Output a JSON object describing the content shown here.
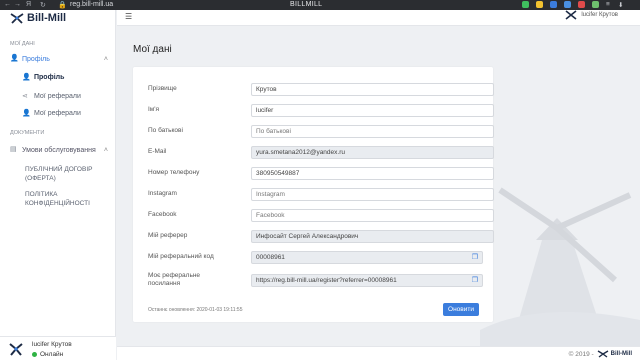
{
  "browser": {
    "url": "reg.bill-mill.ua",
    "title": "BILLMILL",
    "menu_glyph": "Я"
  },
  "brand": {
    "name": "Bill-Mill"
  },
  "sidebar": {
    "section_my_data": "МОЇ ДАНІ",
    "profile_group": "Профіль",
    "items": [
      {
        "label": "Профіль"
      },
      {
        "label": "Мої реферали"
      },
      {
        "label": "Мої реферали"
      }
    ],
    "section_documents": "ДОКУМЕНТИ",
    "terms_group": "Умови обслуговування",
    "docs": [
      {
        "label": "ПУБЛІЧНИЙ ДОГОВІР (Оферта)"
      },
      {
        "label": "ПОЛІТИКА КОНФІДЕНЦІЙНОСТІ"
      }
    ]
  },
  "user": {
    "name": "lucifer Крутов",
    "status": "Онлайн"
  },
  "topbar": {
    "user_name": "lucifer Крутов"
  },
  "page": {
    "title": "Мої дані"
  },
  "form": {
    "fields": [
      {
        "label": "Прізвище",
        "value": "Крутов",
        "placeholder": ""
      },
      {
        "label": "Ім'я",
        "value": "lucifer",
        "placeholder": ""
      },
      {
        "label": "По батькові",
        "value": "",
        "placeholder": "По батькові"
      },
      {
        "label": "E-Mail",
        "value": "yura.smetana2012@yandex.ru",
        "placeholder": ""
      },
      {
        "label": "Номер телефону",
        "value": "380950549887",
        "placeholder": ""
      },
      {
        "label": "Instagram",
        "value": "",
        "placeholder": "Instagram"
      },
      {
        "label": "Facebook",
        "value": "",
        "placeholder": "Facebook"
      },
      {
        "label": "Мій реферер",
        "value": "Инфосайт Сергей Александрович",
        "placeholder": ""
      },
      {
        "label": "Мій реферальний код",
        "value": "00008961",
        "placeholder": ""
      },
      {
        "label": "Моє реферальне посилання",
        "value": "https://reg.bill-mill.ua/register?referrer=00008961",
        "placeholder": ""
      }
    ],
    "last_updated": "Останнє оновлення: 2020-01-03 19:11:55",
    "submit_label": "Оновити"
  },
  "footer": {
    "copyright": "© 2019 -"
  },
  "colors": {
    "accent": "#3b7ddd",
    "online": "#2fb344",
    "brand": "#1d2b45"
  }
}
